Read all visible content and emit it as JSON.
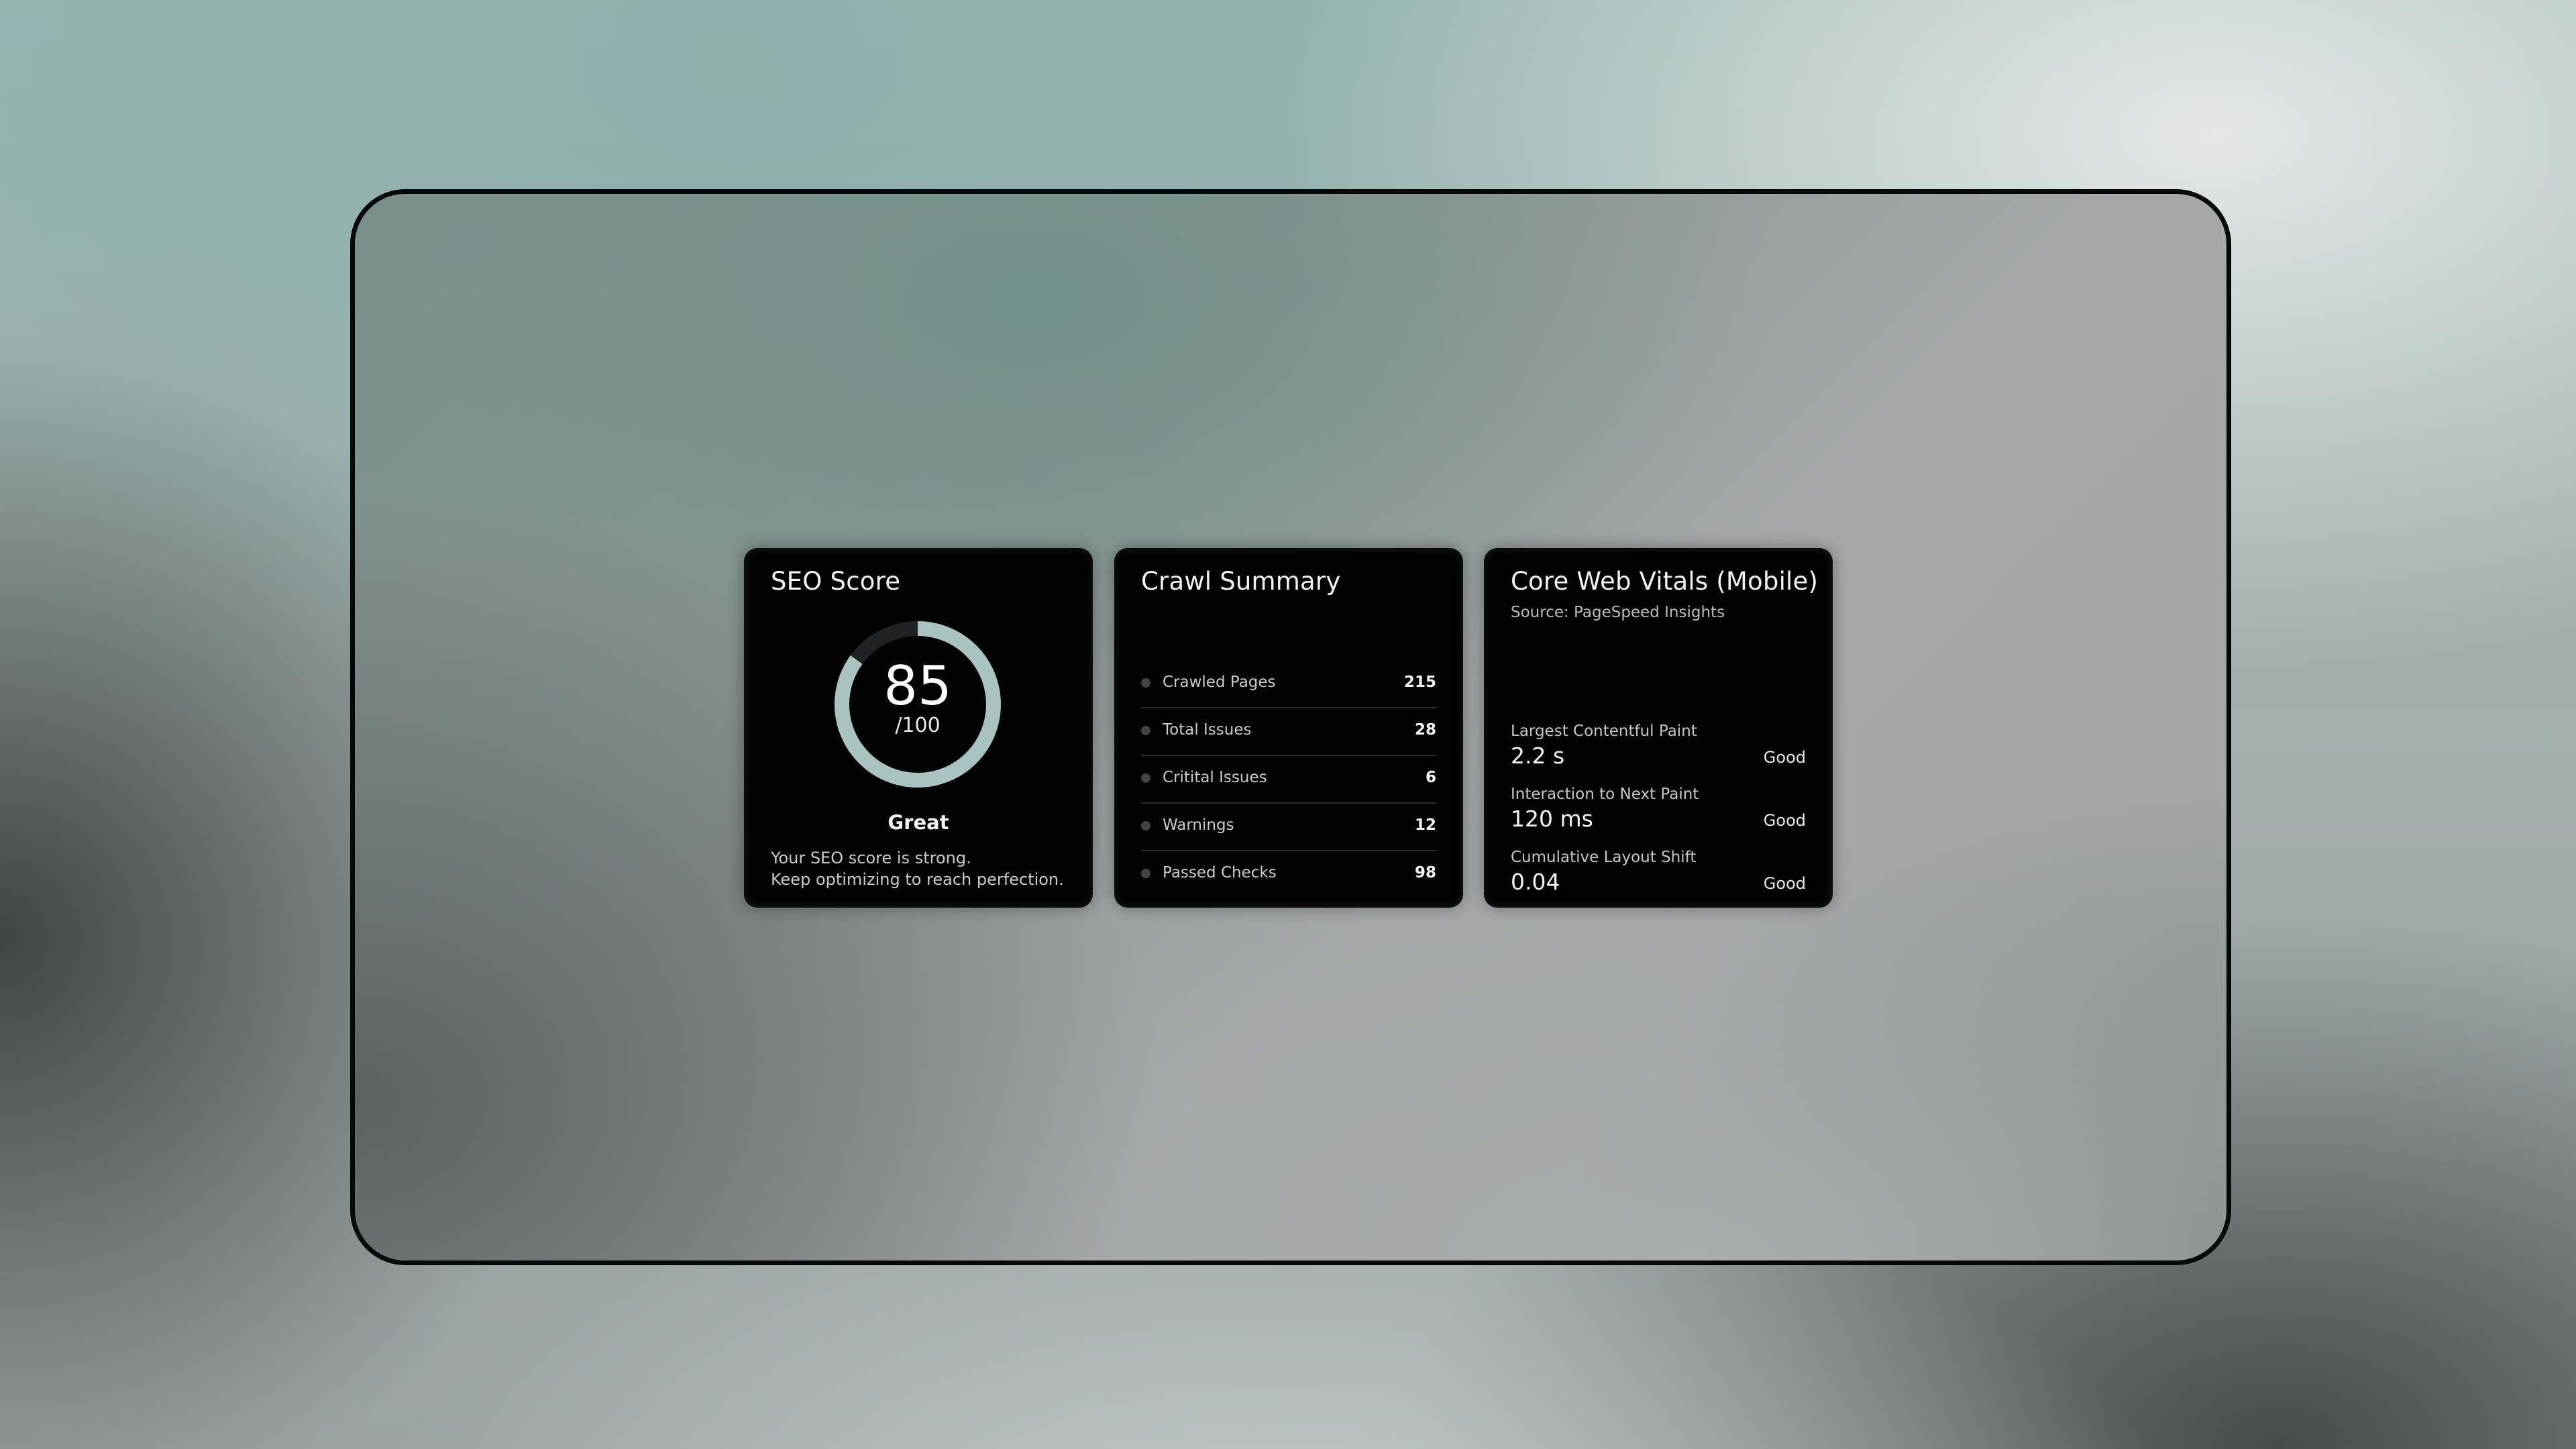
{
  "colors": {
    "card_background": "#020202",
    "gauge_fill": "#a9c3c0",
    "gauge_track": "#1f2222",
    "frame_border": "#070808"
  },
  "seo_score": {
    "title": "SEO Score",
    "score": "85",
    "max_label": "/100",
    "score_fraction": 0.85,
    "grade": "Great",
    "description_line1": "Your SEO score is strong.",
    "description_line2": "Keep optimizing to reach perfection."
  },
  "crawl_summary": {
    "title": "Crawl Summary",
    "rows": [
      {
        "label": "Crawled Pages",
        "value": "215"
      },
      {
        "label": "Total Issues",
        "value": "28"
      },
      {
        "label": "Critital Issues",
        "value": "6"
      },
      {
        "label": "Warnings",
        "value": "12"
      },
      {
        "label": "Passed Checks",
        "value": "98"
      }
    ]
  },
  "core_web_vitals": {
    "title": "Core Web Vitals (Mobile)",
    "source": "Source: PageSpeed Insights",
    "metrics": [
      {
        "label": "Largest Contentful Paint",
        "value": "2.2 s",
        "status": "Good"
      },
      {
        "label": "Interaction to Next Paint",
        "value": "120 ms",
        "status": "Good"
      },
      {
        "label": "Cumulative Layout Shift",
        "value": "0.04",
        "status": "Good"
      }
    ]
  }
}
